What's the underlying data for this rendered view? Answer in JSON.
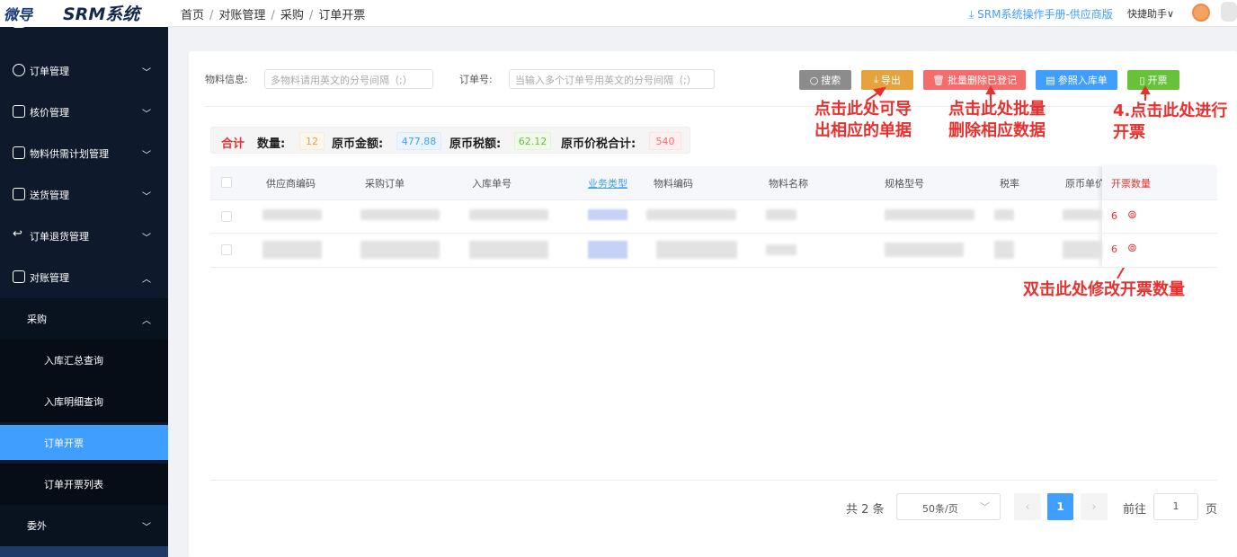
{
  "header": {
    "logo_left": "微导",
    "logo_right": "SRM系统",
    "breadcrumb": [
      "首页",
      "对账管理",
      "采购",
      "订单开票"
    ],
    "breadcrumb_sep": "/",
    "manual_link": "SRM系统操作手册-供应商版",
    "quick_help": "快捷助手"
  },
  "sidebar": {
    "items": [
      {
        "label": "订单管理"
      },
      {
        "label": "核价管理"
      },
      {
        "label": "物料供需计划管理"
      },
      {
        "label": "送货管理"
      },
      {
        "label": "订单退货管理"
      },
      {
        "label": "对账管理"
      },
      {
        "label": "采购"
      },
      {
        "label": "入库汇总查询"
      },
      {
        "label": "入库明细查询"
      },
      {
        "label": "订单开票"
      },
      {
        "label": "订单开票列表"
      },
      {
        "label": "委外"
      }
    ]
  },
  "search": {
    "material_label": "物料信息:",
    "material_placeholder": "多物料请用英文的分号间隔（;）",
    "order_label": "订单号:",
    "order_placeholder": "当输入多个订单号用英文的分号间隔（;）",
    "btn_search": "搜索",
    "btn_export": "导出",
    "btn_batch_delete": "批量删除已登记",
    "btn_ref_receipt": "参照入库单",
    "btn_invoice": "开票"
  },
  "annotations": {
    "export_note_1": "点击此处可导",
    "export_note_2": "出相应的单据",
    "delete_note_1": "点击此处批量",
    "delete_note_2": "删除相应数据",
    "invoice_note_1": "4.点击此处进行",
    "invoice_note_2": "开票",
    "qty_note": "双击此处修改开票数量"
  },
  "summary": {
    "total_label": "合计",
    "qty_label": "数量:",
    "qty_value": "12",
    "amount_label": "原币金额:",
    "amount_value": "477.88",
    "tax_label": "原币税额:",
    "tax_value": "62.12",
    "total_tax_label": "原币价税合计:",
    "total_tax_value": "540"
  },
  "table": {
    "columns": [
      "供应商编码",
      "采购订单",
      "入库单号",
      "业务类型",
      "物料编码",
      "物料名称",
      "规格型号",
      "税率",
      "原币单价",
      "开票数量"
    ],
    "rows": [
      {
        "invoice_qty": "6"
      },
      {
        "invoice_qty": "6"
      }
    ]
  },
  "pagination": {
    "total_text": "共 2 条",
    "page_size": "50条/页",
    "current_page": "1",
    "goto_label": "前往",
    "goto_value": "1",
    "page_suffix": "页"
  },
  "colors": {
    "sidebar_bg": "#0e1a2b",
    "active": "#409eff",
    "annotation": "#e8312f",
    "btn_search": "#8c8c8c",
    "btn_export": "#e6a23c",
    "btn_delete": "#f56c6c",
    "btn_ref": "#409eff",
    "btn_invoice": "#67c23a"
  }
}
